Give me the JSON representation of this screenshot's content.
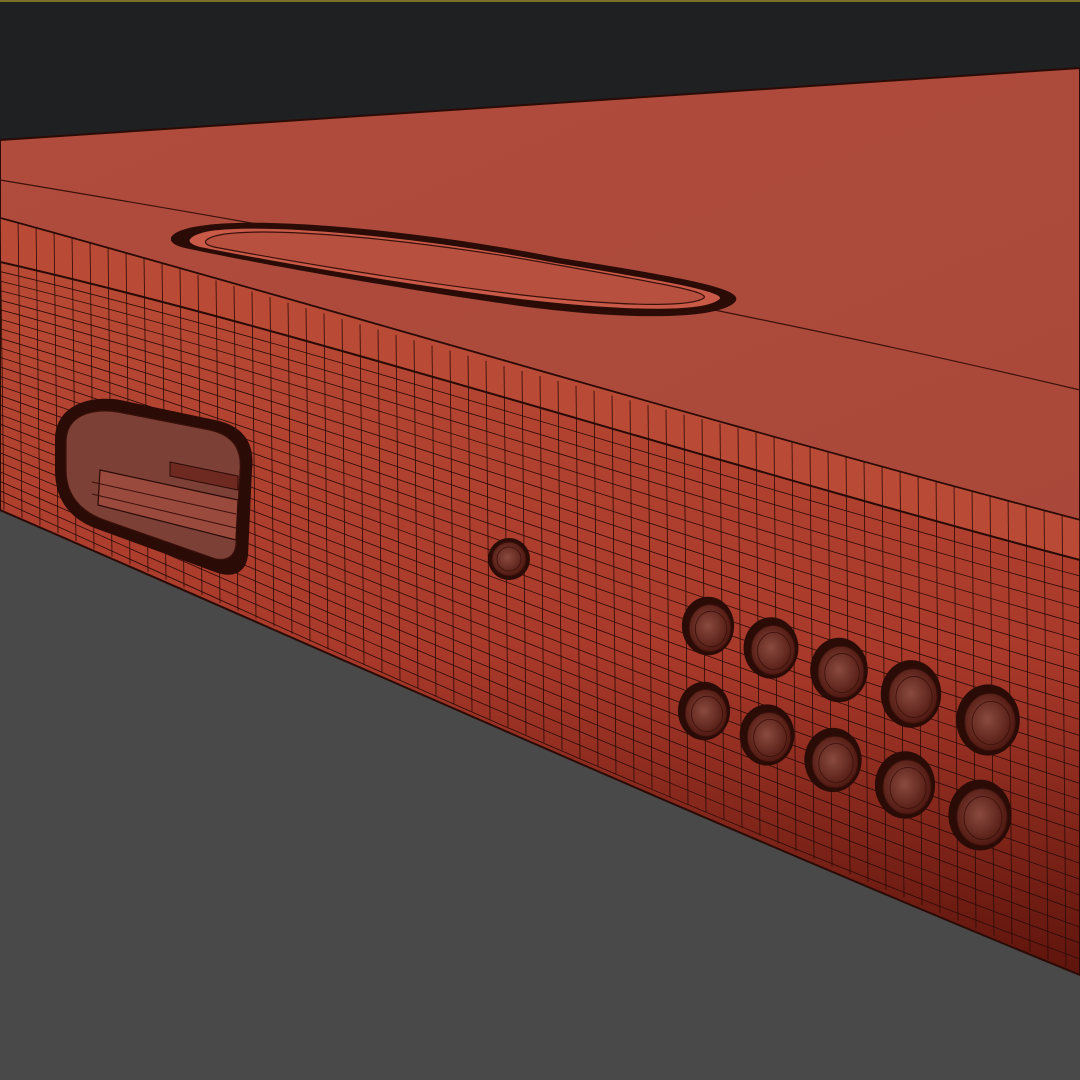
{
  "viewport": {
    "view": "perspective",
    "render_mode": "wireframe-on-shaded",
    "colors": {
      "bg_top": "#1f2021",
      "ground": "#494949",
      "top_border": "#7a7228",
      "body_top": "#ad4a3c",
      "body_side": "#b6432f",
      "body_side_dark": "#6a1a10",
      "wire": "#2a0b06",
      "hole_fill": "#7c4036"
    }
  },
  "model": {
    "name": "smartphone",
    "features": [
      {
        "id": "home-button",
        "shape": "rounded-rect"
      },
      {
        "id": "charging-port",
        "shape": "usb-c-opening"
      },
      {
        "id": "microphone-hole",
        "shape": "circle"
      },
      {
        "id": "speaker-grille",
        "shape": "circle-grid",
        "rows": 2,
        "columns": 5
      }
    ]
  }
}
